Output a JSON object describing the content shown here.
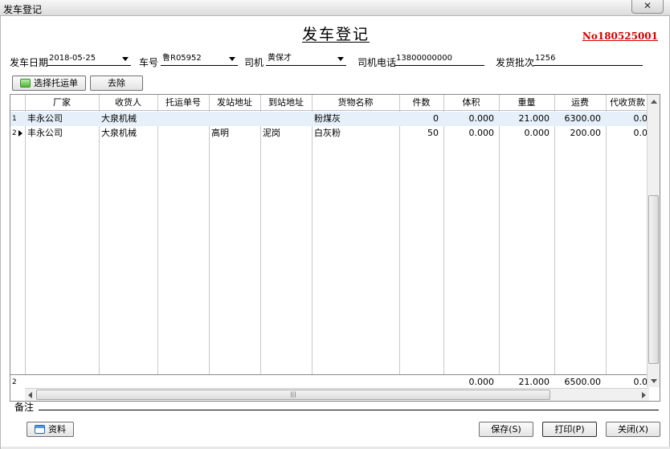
{
  "window": {
    "title": "发车登记",
    "close_label": "✕"
  },
  "form": {
    "heading": "发车登记",
    "doc_no": "No180525001",
    "fields": {
      "date": {
        "label": "发车日期",
        "value": "2018-05-25"
      },
      "plate": {
        "label": "车号",
        "value": "鲁R05952"
      },
      "driver": {
        "label": "司机",
        "value": "黄保才"
      },
      "phone": {
        "label": "司机电话",
        "value": "13800000000"
      },
      "batch": {
        "label": "发货批次",
        "value": "1256"
      }
    }
  },
  "toolbar": {
    "select_label": "选择托运单",
    "remove_label": "去除"
  },
  "grid": {
    "columns": [
      "厂家",
      "收货人",
      "托运单号",
      "发站地址",
      "到站地址",
      "货物名称",
      "件数",
      "体积",
      "重量",
      "运费",
      "代收货款"
    ],
    "rows": [
      {
        "num": "1",
        "cells": [
          "丰永公司",
          "大泉机械",
          "",
          "",
          "",
          "粉煤灰",
          "0",
          "0.000",
          "21.000",
          "6300.00",
          "0.0"
        ]
      },
      {
        "num": "2",
        "cells": [
          "丰永公司",
          "大泉机械",
          "",
          "高明",
          "泥岗",
          "白灰粉",
          "50",
          "0.000",
          "0.000",
          "200.00",
          "0.0"
        ]
      }
    ],
    "summary": {
      "num": "2",
      "cells": [
        "",
        "",
        "",
        "",
        "",
        "",
        "",
        "0.000",
        "21.000",
        "6500.00",
        "0.0"
      ]
    }
  },
  "remark": {
    "label": "备注",
    "value": ""
  },
  "footer": {
    "info_label": "资料",
    "save_label": "保存(S)",
    "print_label": "打印(P)",
    "close_label": "关闭(X)"
  }
}
